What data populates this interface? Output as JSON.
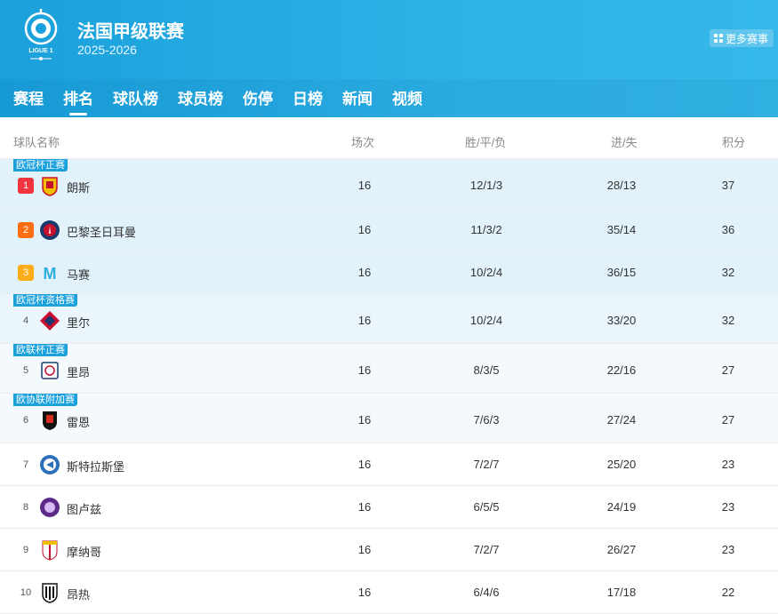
{
  "header": {
    "logo_text": "LIGUE 1",
    "title": "法国甲级联赛",
    "season": "2025-2026",
    "more_label": "更多赛事"
  },
  "nav": {
    "tabs": [
      {
        "label": "赛程",
        "active": false
      },
      {
        "label": "排名",
        "active": true
      },
      {
        "label": "球队榜",
        "active": false
      },
      {
        "label": "球员榜",
        "active": false
      },
      {
        "label": "伤停",
        "active": false
      },
      {
        "label": "日榜",
        "active": false
      },
      {
        "label": "新闻",
        "active": false
      },
      {
        "label": "视频",
        "active": false
      }
    ]
  },
  "table": {
    "headers": {
      "team": "球队名称",
      "played": "场次",
      "wdl": "胜/平/负",
      "goals": "进/失",
      "points": "积分"
    },
    "rows": [
      {
        "rank": "1",
        "team": "朗斯",
        "badge": "lens-badge",
        "played": "16",
        "wdl": "12/1/3",
        "goals": "28/13",
        "points": "37",
        "zone_label": "欧冠杯正赛"
      },
      {
        "rank": "2",
        "team": "巴黎圣日耳曼",
        "badge": "psg-badge",
        "played": "16",
        "wdl": "11/3/2",
        "goals": "35/14",
        "points": "36",
        "zone_label": ""
      },
      {
        "rank": "3",
        "team": "马赛",
        "badge": "marseille-badge",
        "played": "16",
        "wdl": "10/2/4",
        "goals": "36/15",
        "points": "32",
        "zone_label": ""
      },
      {
        "rank": "4",
        "team": "里尔",
        "badge": "lille-badge",
        "played": "16",
        "wdl": "10/2/4",
        "goals": "33/20",
        "points": "32",
        "zone_label": "欧冠杯资格赛"
      },
      {
        "rank": "5",
        "team": "里昂",
        "badge": "lyon-badge",
        "played": "16",
        "wdl": "8/3/5",
        "goals": "22/16",
        "points": "27",
        "zone_label": "欧联杯正赛"
      },
      {
        "rank": "6",
        "team": "雷恩",
        "badge": "rennes-badge",
        "played": "16",
        "wdl": "7/6/3",
        "goals": "27/24",
        "points": "27",
        "zone_label": "欧协联附加赛"
      },
      {
        "rank": "7",
        "team": "斯特拉斯堡",
        "badge": "strasbourg-badge",
        "played": "16",
        "wdl": "7/2/7",
        "goals": "25/20",
        "points": "23",
        "zone_label": ""
      },
      {
        "rank": "8",
        "team": "图卢兹",
        "badge": "toulouse-badge",
        "played": "16",
        "wdl": "6/5/5",
        "goals": "24/19",
        "points": "23",
        "zone_label": ""
      },
      {
        "rank": "9",
        "team": "摩纳哥",
        "badge": "monaco-badge",
        "played": "16",
        "wdl": "7/2/7",
        "goals": "26/27",
        "points": "23",
        "zone_label": ""
      },
      {
        "rank": "10",
        "team": "昂热",
        "badge": "angers-badge",
        "played": "16",
        "wdl": "6/4/6",
        "goals": "17/18",
        "points": "22",
        "zone_label": ""
      }
    ]
  },
  "colors": {
    "header_blue": "#1aa0dc",
    "rank1": "#f2343f",
    "rank2": "#ff6d12",
    "rank3": "#ffac1a"
  }
}
